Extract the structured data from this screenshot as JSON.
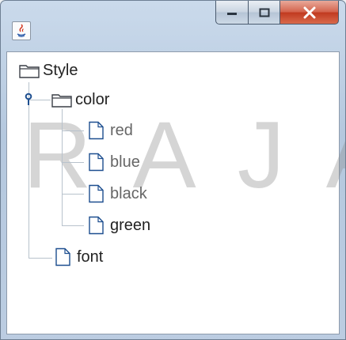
{
  "window": {
    "controls": {
      "minimize": "minimize",
      "maximize": "maximize",
      "close": "close"
    }
  },
  "tree": {
    "root": {
      "label": "Style",
      "icon": "folder-icon"
    },
    "color": {
      "label": "color",
      "icon": "folder-icon",
      "expanded": true
    },
    "leaves": [
      {
        "label": "red",
        "icon": "file-icon"
      },
      {
        "label": "blue",
        "icon": "file-icon"
      },
      {
        "label": "black",
        "icon": "file-icon"
      },
      {
        "label": "green",
        "icon": "file-icon"
      }
    ],
    "font": {
      "label": "font",
      "icon": "file-icon"
    }
  },
  "colors": {
    "accent": "#1d4e8f",
    "titlebar": "#b8cbe2",
    "close": "#c9452d"
  }
}
